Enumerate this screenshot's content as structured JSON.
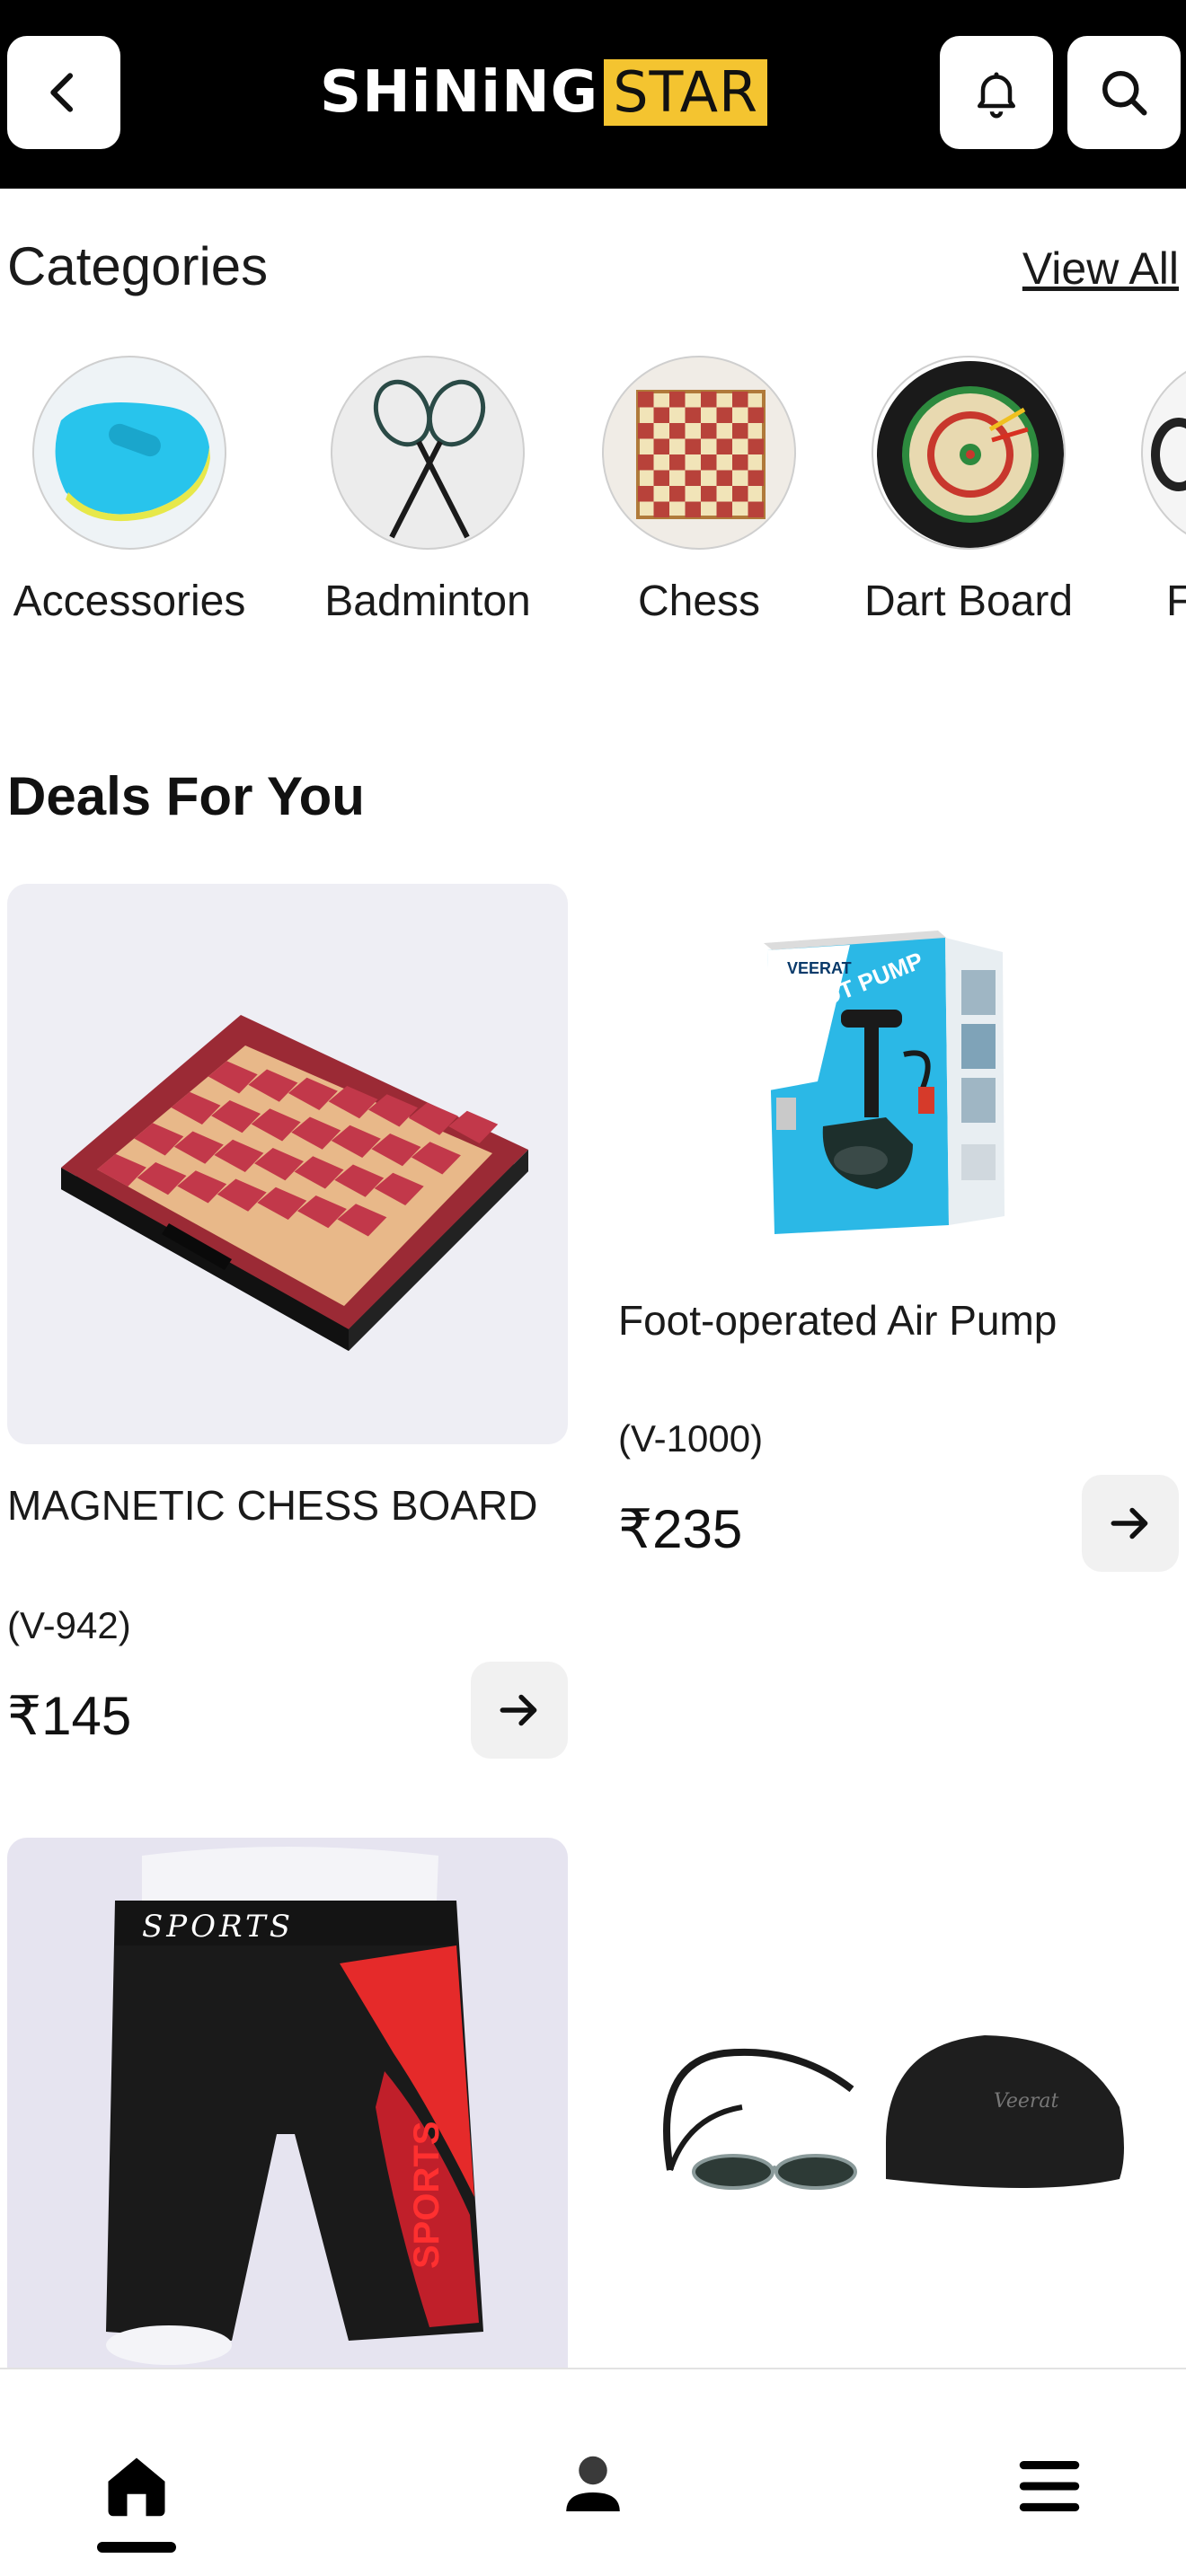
{
  "header": {
    "logo_part1": "SHiNiNG",
    "logo_part2": "STAR",
    "back_icon": "chevron-left-icon",
    "bell_icon": "bell-icon",
    "search_icon": "search-icon",
    "accent": "#f4c430",
    "background": "#000000"
  },
  "categories": {
    "title": "Categories",
    "view_all": "View All",
    "items": [
      {
        "label": "Accessories",
        "icon": "kickboard-icon"
      },
      {
        "label": "Badminton",
        "icon": "badminton-rackets-icon"
      },
      {
        "label": "Chess",
        "icon": "chess-board-icon"
      },
      {
        "label": "Dart Board",
        "icon": "dart-board-icon"
      },
      {
        "label": "F",
        "icon": "goggles-icon"
      }
    ]
  },
  "deals": {
    "title": "Deals For You",
    "products": [
      {
        "name": "MAGNETIC CHESS BOARD",
        "code": "(V-942)",
        "price": "₹145"
      },
      {
        "name": "Foot-operated Air Pump",
        "code": "(V-1000)",
        "price": "₹235"
      },
      {
        "name": "",
        "code": "",
        "price": ""
      },
      {
        "name": "",
        "code": "",
        "price": ""
      }
    ],
    "image_text": {
      "pump_brand": "VEERAT",
      "pump_label": "FOOT PUMP",
      "shorts_text": "SPORTS",
      "shorts_side_text": "SPORTS",
      "cap_text": "Veerat"
    }
  },
  "bottom_nav": {
    "home_icon": "home-icon",
    "profile_icon": "profile-icon",
    "menu_icon": "menu-icon"
  }
}
